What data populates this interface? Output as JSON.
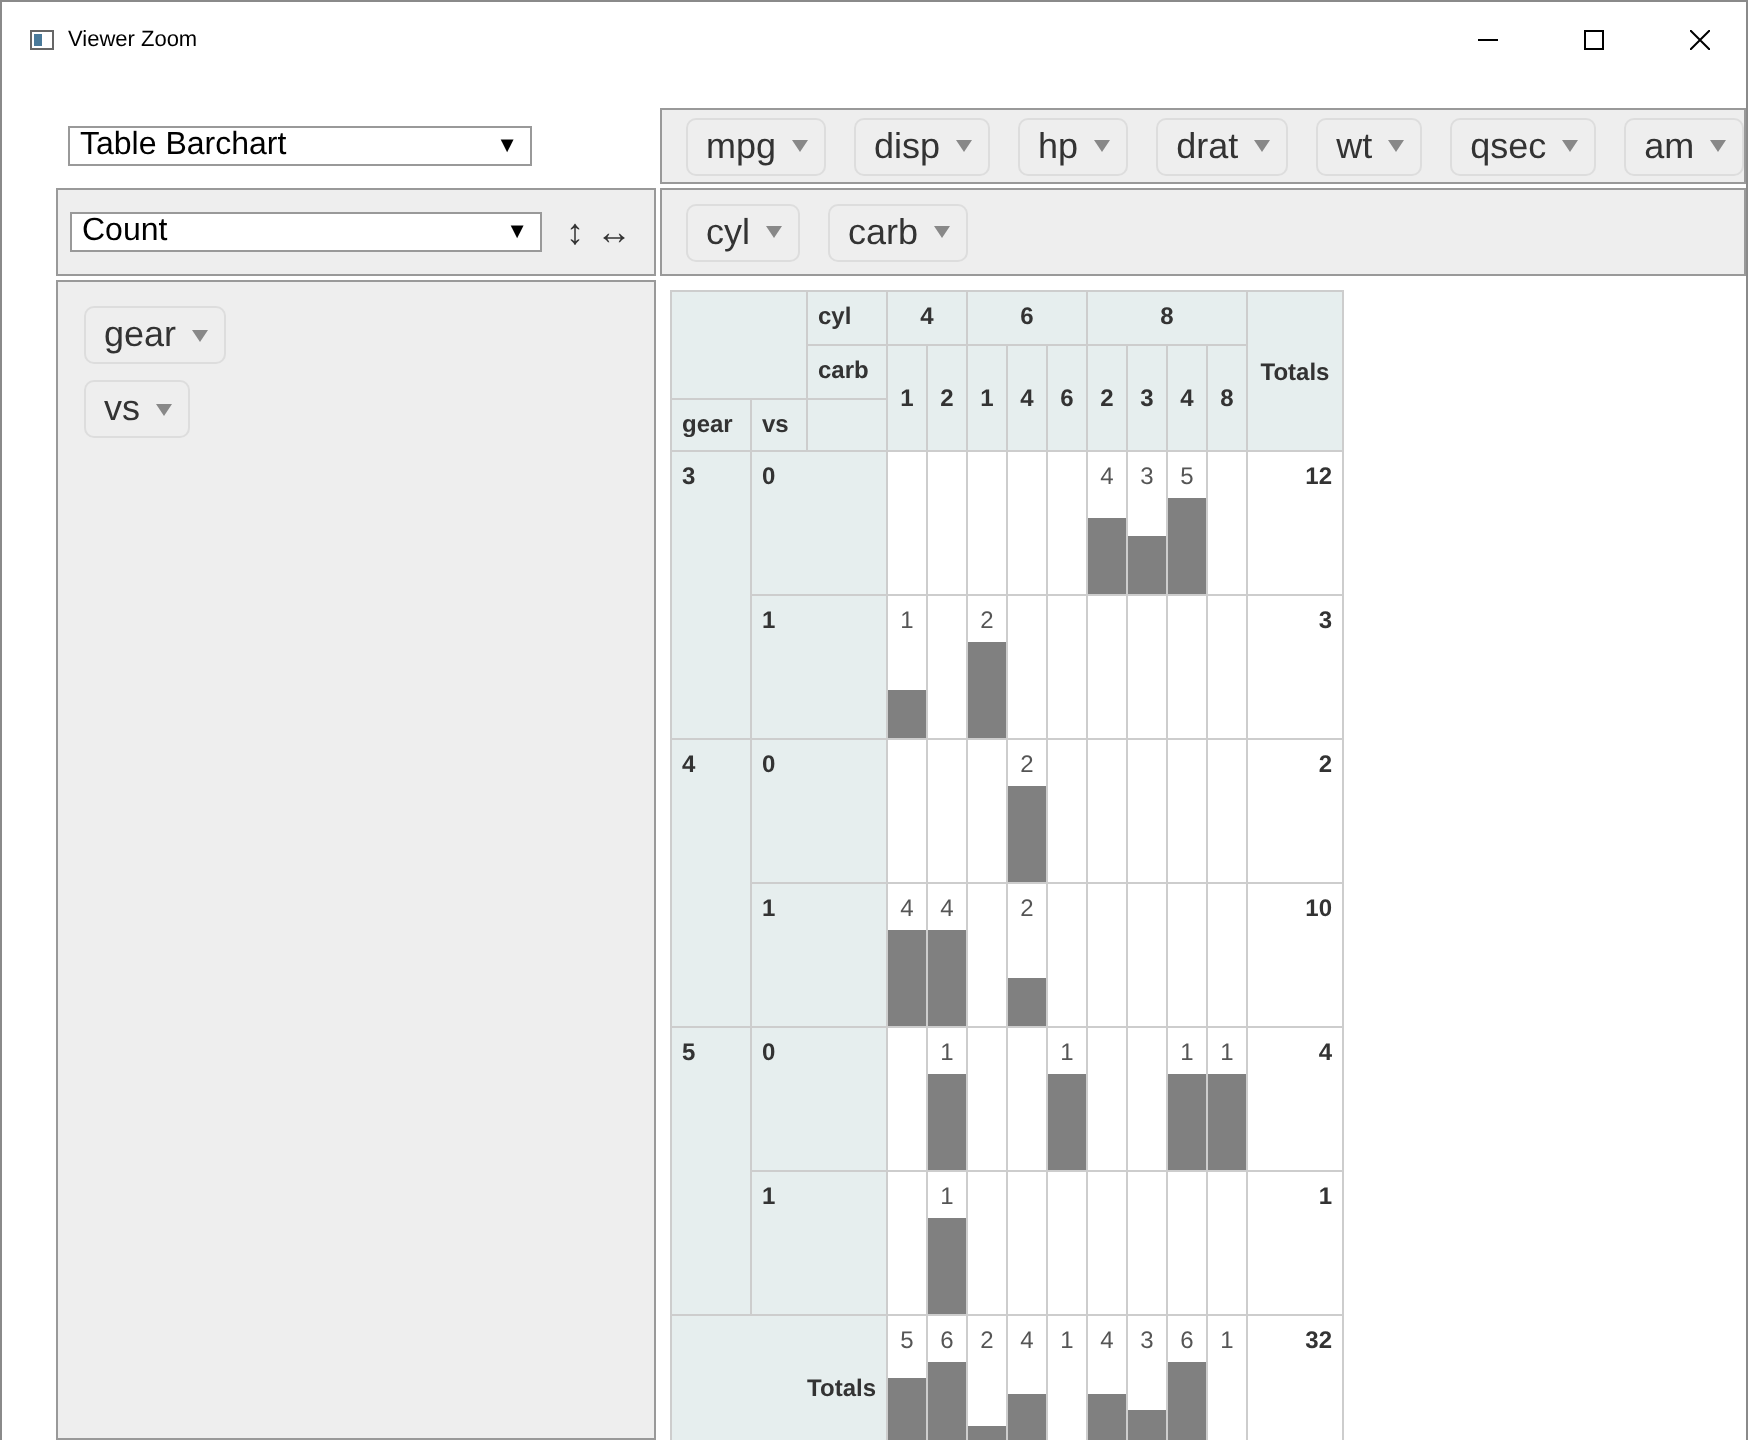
{
  "window": {
    "title": "Viewer Zoom"
  },
  "renderer": {
    "value": "Table Barchart",
    "caret": "▼"
  },
  "unused_fields": [
    {
      "label": "mpg"
    },
    {
      "label": "disp"
    },
    {
      "label": "hp"
    },
    {
      "label": "drat"
    },
    {
      "label": "wt"
    },
    {
      "label": "qsec"
    },
    {
      "label": "am"
    }
  ],
  "aggregator": {
    "value": "Count",
    "caret": "▼",
    "row_order_toggle": "↕",
    "col_order_toggle": "↔"
  },
  "column_fields": [
    {
      "label": "cyl"
    },
    {
      "label": "carb"
    }
  ],
  "row_fields": [
    {
      "label": "gear"
    },
    {
      "label": "vs"
    }
  ],
  "table": {
    "column_field_labels": [
      "cyl",
      "carb"
    ],
    "row_field_labels": [
      "gear",
      "vs"
    ],
    "column_groups": [
      {
        "label": "4",
        "subcolumns": [
          "1",
          "2"
        ]
      },
      {
        "label": "6",
        "subcolumns": [
          "1",
          "4",
          "6"
        ]
      },
      {
        "label": "8",
        "subcolumns": [
          "2",
          "3",
          "4",
          "8"
        ]
      }
    ],
    "totals_label": "Totals",
    "row_groups": [
      {
        "label": "3",
        "rows": [
          {
            "label": "0",
            "cells": [
              null,
              null,
              null,
              null,
              null,
              "4",
              "3",
              "5",
              null
            ],
            "total": "12"
          },
          {
            "label": "1",
            "cells": [
              "1",
              null,
              "2",
              null,
              null,
              null,
              null,
              null,
              null
            ],
            "total": "3"
          }
        ]
      },
      {
        "label": "4",
        "rows": [
          {
            "label": "0",
            "cells": [
              null,
              null,
              null,
              "2",
              null,
              null,
              null,
              null,
              null
            ],
            "total": "2"
          },
          {
            "label": "1",
            "cells": [
              "4",
              "4",
              null,
              "2",
              null,
              null,
              null,
              null,
              null
            ],
            "total": "10"
          }
        ]
      },
      {
        "label": "5",
        "rows": [
          {
            "label": "0",
            "cells": [
              null,
              "1",
              null,
              null,
              "1",
              null,
              null,
              "1",
              "1"
            ],
            "total": "4"
          },
          {
            "label": "1",
            "cells": [
              null,
              "1",
              null,
              null,
              null,
              null,
              null,
              null,
              null
            ],
            "total": "1"
          }
        ]
      }
    ],
    "totals_row": {
      "label": "Totals",
      "cells": [
        "5",
        "6",
        "2",
        "4",
        "1",
        "4",
        "3",
        "6",
        "1"
      ],
      "total": "32"
    }
  }
}
